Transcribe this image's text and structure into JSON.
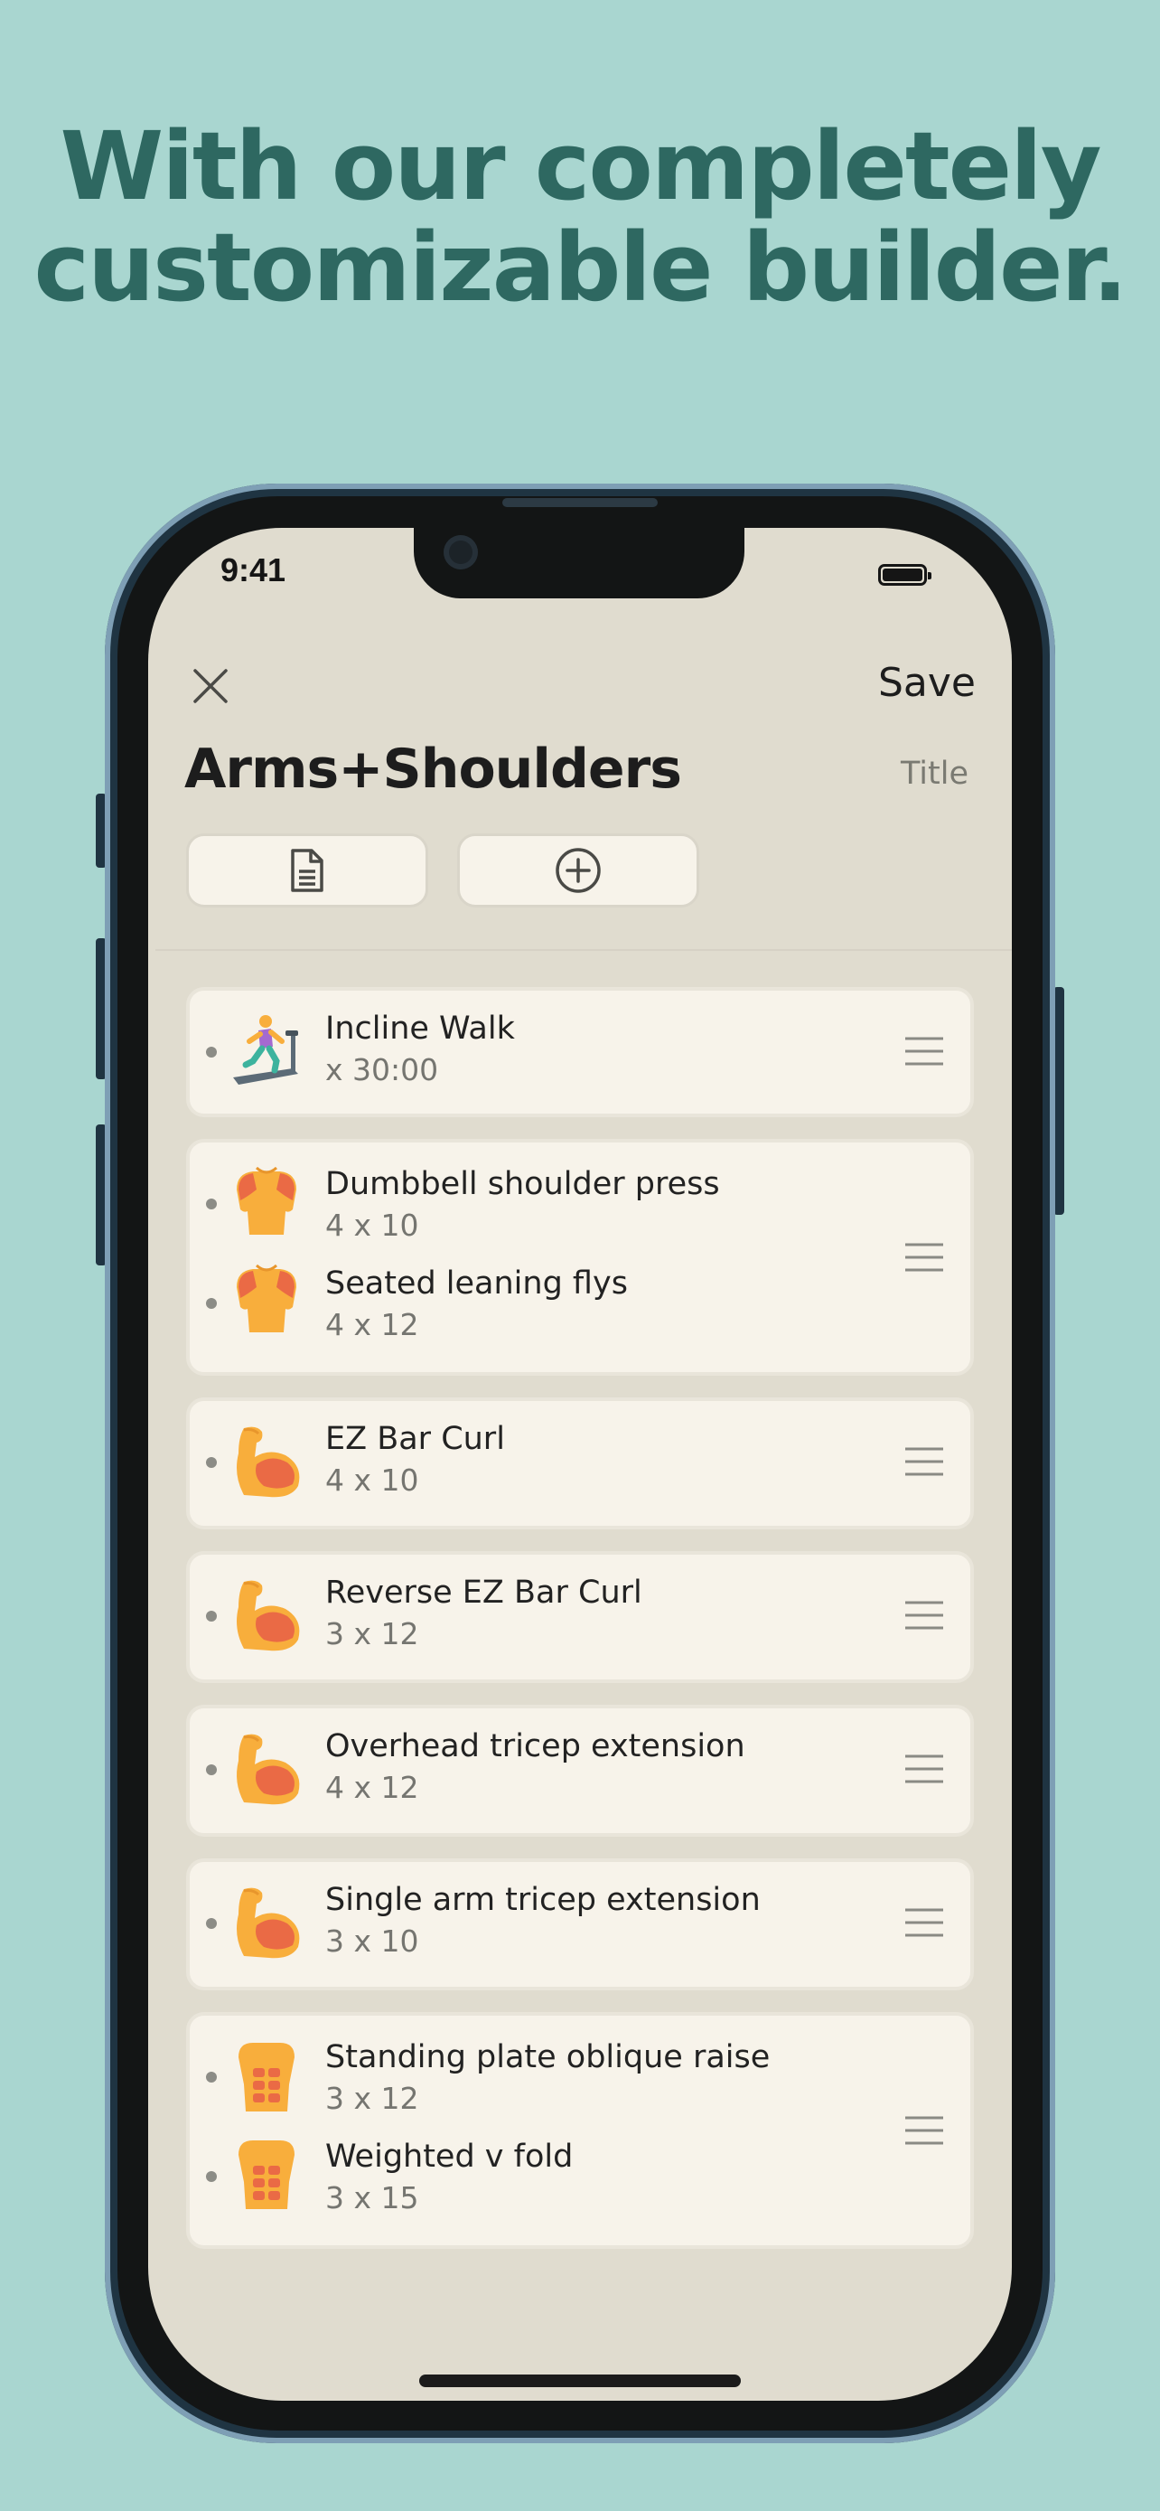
{
  "headline": {
    "line1": "With our completely",
    "line2": "customizable builder."
  },
  "status_bar": {
    "time": "9:41"
  },
  "header": {
    "save_label": "Save",
    "title": "Arms+Shoulders",
    "title_label": "Title"
  },
  "actions": {
    "notes_icon": "document-icon",
    "add_icon": "plus-circle-icon"
  },
  "workouts": [
    {
      "exercises": [
        {
          "name": "Incline Walk",
          "sets": "x 30:00",
          "icon": "treadmill-icon"
        }
      ]
    },
    {
      "exercises": [
        {
          "name": "Dumbbell shoulder press",
          "sets": "4 x 10",
          "icon": "shoulders-icon"
        },
        {
          "name": "Seated leaning flys",
          "sets": "4 x 12",
          "icon": "shoulders-icon"
        }
      ]
    },
    {
      "exercises": [
        {
          "name": "EZ Bar Curl",
          "sets": "4 x 10",
          "icon": "bicep-icon"
        }
      ]
    },
    {
      "exercises": [
        {
          "name": "Reverse EZ Bar Curl",
          "sets": "3 x 12",
          "icon": "bicep-icon"
        }
      ]
    },
    {
      "exercises": [
        {
          "name": "Overhead tricep extension",
          "sets": "4 x 12",
          "icon": "bicep-icon"
        }
      ]
    },
    {
      "exercises": [
        {
          "name": "Single arm tricep extension",
          "sets": "3 x 10",
          "icon": "bicep-icon"
        }
      ]
    },
    {
      "exercises": [
        {
          "name": "Standing plate oblique raise",
          "sets": "3 x 12",
          "icon": "abs-icon"
        },
        {
          "name": "Weighted v fold",
          "sets": "3 x 15",
          "icon": "abs-icon"
        }
      ]
    }
  ],
  "colors": {
    "background": "#a9d6d0",
    "headline": "#2e6861",
    "screen": "#e0dccf",
    "card": "#f7f3ea",
    "icon_orange": "#f8ae3c",
    "muscle_red": "#ea6a45"
  }
}
